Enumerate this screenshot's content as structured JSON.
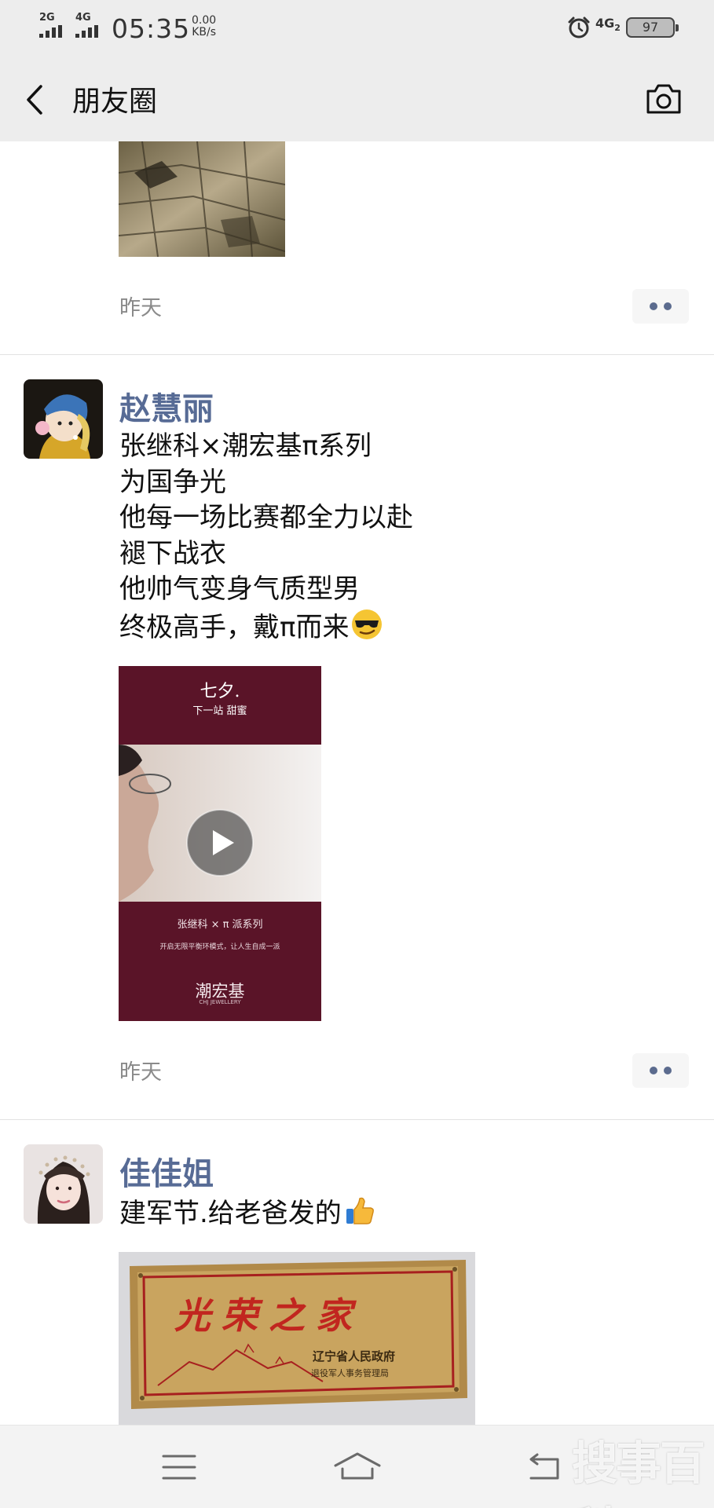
{
  "status_bar": {
    "net1": "2G",
    "net2": "4G",
    "time": "05:35",
    "speed_value": "0.00",
    "speed_unit": "KB/s",
    "net3": "4G",
    "net3_sub": "2",
    "battery": "97"
  },
  "nav": {
    "title": "朋友圈",
    "back_icon": "back-arrow-icon",
    "camera_icon": "camera-icon"
  },
  "posts": [
    {
      "image": "street-pavement-photo",
      "time": "昨天"
    },
    {
      "author": "赵慧丽",
      "avatar": "girl-with-pearl-earring-avatar",
      "lines": [
        "张继科×潮宏基π系列",
        "为国争光",
        "他每一场比赛都全力以赴",
        "褪下战衣",
        "他帅气变身气质型男",
        "终极高手，戴π而来"
      ],
      "emoji": "cool-sunglasses-emoji",
      "video": {
        "title_top": "七夕.",
        "title_sub": "下一站 甜蜜",
        "caption": "张继科 × π 派系列",
        "subcaption": "开启无限平衡环模式，让人生自成一派",
        "brand": "潮宏基",
        "brand_en": "CHJ JEWELLERY",
        "play_icon": "play-icon"
      },
      "time": "昨天"
    },
    {
      "author": "佳佳姐",
      "avatar": "woman-portrait-avatar",
      "lines": [
        "建军节.给老爸发的"
      ],
      "emoji": "thumbs-up-emoji",
      "plaque": {
        "title": "光荣之家",
        "org": "辽宁省人民政府",
        "dept": "退役军人事务管理局"
      }
    }
  ],
  "bottom_nav": {
    "menu_icon": "menu-icon",
    "home_icon": "home-icon",
    "back_icon": "return-icon"
  },
  "watermark": "搜事百科",
  "colors": {
    "nickname": "#576b95",
    "bar_bg": "#ededed",
    "time_gray": "#8a8a8a"
  }
}
